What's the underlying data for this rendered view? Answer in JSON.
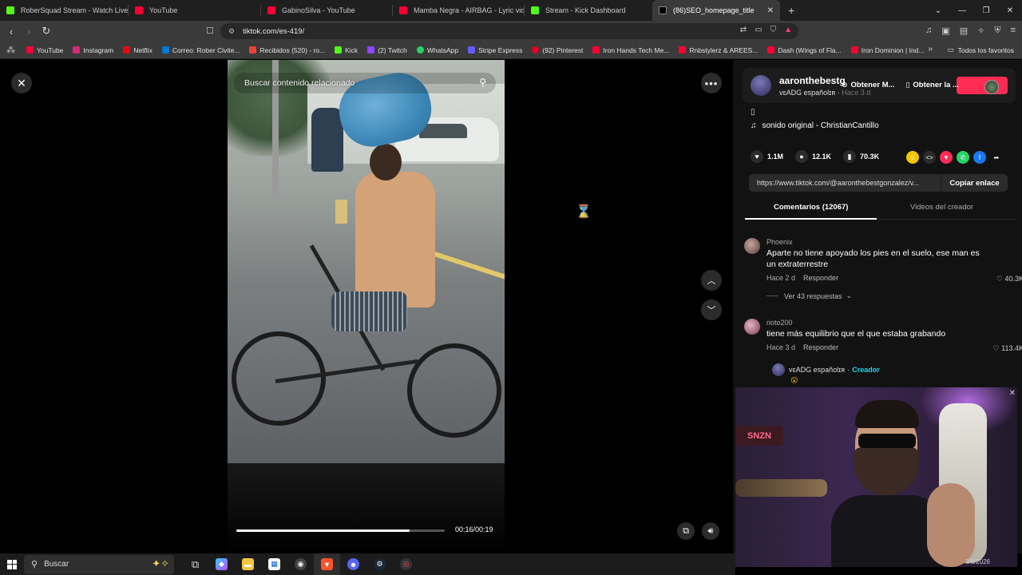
{
  "browser": {
    "tabs": [
      {
        "label": "RoberSquad Stream - Watch Live",
        "favicon_color": "#53fc18"
      },
      {
        "label": "YouTube",
        "favicon_color": "#ff0033"
      },
      {
        "label": "GabinoSilva - YouTube",
        "favicon_color": "#ff0033"
      },
      {
        "label": "Mamba Negra - AIRBAG - Lyric video",
        "favicon_color": "#ff0033"
      },
      {
        "label": "Stream - Kick Dashboard",
        "favicon_color": "#53fc18"
      },
      {
        "label": "(86)SEO_homepage_title",
        "favicon_color": "#000000",
        "active": true
      }
    ],
    "url": "tiktok.com/es-419/",
    "bookmarks": [
      {
        "label": "YouTube",
        "color": "#ff0033"
      },
      {
        "label": "Instagram",
        "color": "#d62976"
      },
      {
        "label": "Netflix",
        "color": "#e50914"
      },
      {
        "label": "Correo: Rober Civite...",
        "color": "#0078d4"
      },
      {
        "label": "Recibidos (520) - ro...",
        "color": "#ea4335"
      },
      {
        "label": "Kick",
        "color": "#53fc18"
      },
      {
        "label": "(2) Twitch",
        "color": "#9146ff"
      },
      {
        "label": "WhatsApp",
        "color": "#25d366"
      },
      {
        "label": "Stripe Express",
        "color": "#635bff"
      },
      {
        "label": "(92) Pinterest",
        "color": "#e60023"
      },
      {
        "label": "Iron Hands Tech Me...",
        "color": "#ff0033"
      },
      {
        "label": "Rnbstylerz & AREES...",
        "color": "#ff0033"
      },
      {
        "label": "Dash (Wings of Fla...",
        "color": "#ff0033"
      },
      {
        "label": "Iron Dominion | Ind...",
        "color": "#ff0033"
      }
    ],
    "all_bookmarks_label": "Todos los favoritos"
  },
  "video": {
    "search_placeholder": "Buscar contenido relacionado",
    "time": "00:16/00:19",
    "progress": 0.83
  },
  "author": {
    "username": "aaronthebestg",
    "nickname": "vɛADG españolɪʀ",
    "age": "Hace 3 d",
    "get_btn1": "Obtener M...",
    "get_btn2": "Obtener la ..."
  },
  "description": {
    "glyph": "▯",
    "sound": "sonido original - ChristianCantillo"
  },
  "stats": {
    "likes": "1.1M",
    "comments": "12.1K",
    "saves": "70.3K"
  },
  "share": {
    "link": "https://www.tiktok.com/@aaronthebestgonzalez/v...",
    "copy_label": "Copiar enlace"
  },
  "tabs": {
    "comments": "Comentarios (12067)",
    "creator_videos": "Videos del creador"
  },
  "comments": [
    {
      "user": "Phoenix",
      "text": "Aparte no tiene apoyado los pies en el suelo, ese man es un extraterrestre",
      "age": "Hace 2 d",
      "reply": "Responder",
      "likes": "40.3K",
      "replies": "Ver 43 respuestas"
    },
    {
      "user": "rioto200",
      "text": "tiene más equilibrio que el que estaba grabando",
      "age": "Hace 3 d",
      "reply": "Responder",
      "likes": "113.4K"
    }
  ],
  "creator_reply": {
    "name": "vɛADG españolɪʀ",
    "sep": "·",
    "badge": "Creador",
    "emoji": "😮"
  },
  "webcam": {
    "sign": "SNZN",
    "date": "3/6/2026"
  },
  "taskbar": {
    "search_label": "Buscar"
  }
}
